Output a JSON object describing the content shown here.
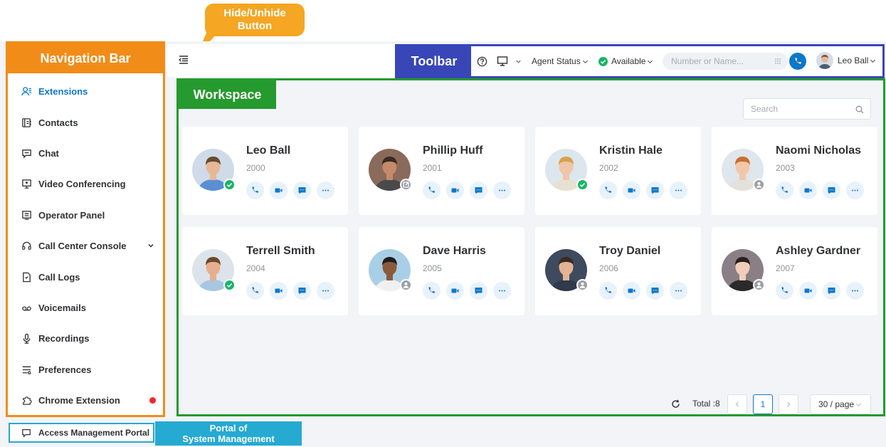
{
  "annotations": {
    "hide_button_line1": "Hide/Unhide",
    "hide_button_line2": "Button",
    "navigation_bar": "Navigation Bar",
    "toolbar": "Toolbar",
    "workspace": "Workspace",
    "portal_line1": "Portal of",
    "portal_line2": "System Management"
  },
  "sidebar": {
    "items": [
      {
        "label": "Extensions",
        "icon": "extensions-icon",
        "active": true
      },
      {
        "label": "Contacts",
        "icon": "contacts-icon"
      },
      {
        "label": "Chat",
        "icon": "chat-icon"
      },
      {
        "label": "Video Conferencing",
        "icon": "video-conferencing-icon"
      },
      {
        "label": "Operator Panel",
        "icon": "operator-panel-icon"
      },
      {
        "label": "Call Center Console",
        "icon": "headset-icon",
        "expandable": true
      },
      {
        "label": "Call Logs",
        "icon": "call-logs-icon"
      },
      {
        "label": "Voicemails",
        "icon": "voicemail-icon"
      },
      {
        "label": "Recordings",
        "icon": "microphone-icon"
      },
      {
        "label": "Preferences",
        "icon": "preferences-icon"
      },
      {
        "label": "Chrome Extension",
        "icon": "puzzle-icon",
        "notification": true
      }
    ],
    "access_portal": "Access Management Portal"
  },
  "toolbar": {
    "agent_status": "Agent Status",
    "availability": "Available",
    "dial_placeholder": "Number or Name...",
    "user_name": "Leo Ball"
  },
  "workspace": {
    "search_placeholder": "Search",
    "extensions": [
      {
        "name": "Leo Ball",
        "number": "2000",
        "status": "available"
      },
      {
        "name": "Phillip Huff",
        "number": "2001",
        "status": "external"
      },
      {
        "name": "Kristin Hale",
        "number": "2002",
        "status": "available"
      },
      {
        "name": "Naomi Nicholas",
        "number": "2003",
        "status": "offline"
      },
      {
        "name": "Terrell Smith",
        "number": "2004",
        "status": "available"
      },
      {
        "name": "Dave Harris",
        "number": "2005",
        "status": "offline"
      },
      {
        "name": "Troy Daniel",
        "number": "2006",
        "status": "offline"
      },
      {
        "name": "Ashley Gardner",
        "number": "2007",
        "status": "offline"
      }
    ],
    "pagination": {
      "total": "Total :8",
      "current_page": "1",
      "page_size": "30 / page"
    }
  },
  "colors": {
    "accent": "#0e78c9",
    "available": "#18b566",
    "navigation_bar": "#f28c18",
    "toolbar": "#3846b8",
    "workspace": "#259a2e",
    "portal": "#25aad2",
    "notification": "#f5222d"
  }
}
